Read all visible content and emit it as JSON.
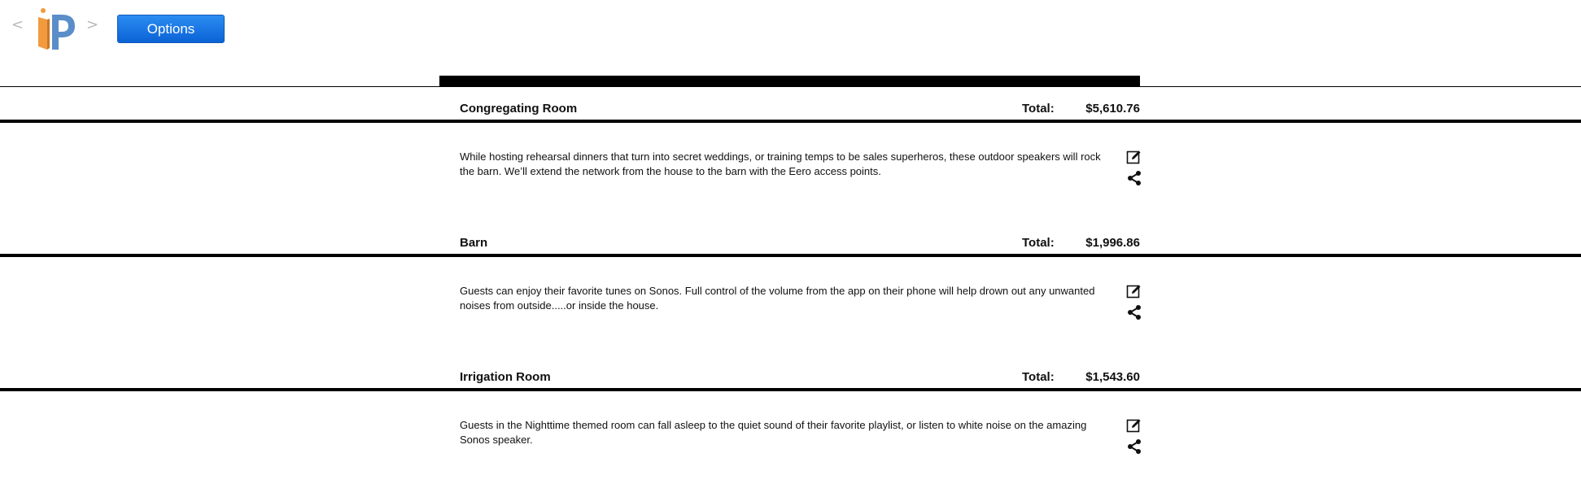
{
  "nav": {
    "prev_label": "<",
    "next_label": ">"
  },
  "toolbar": {
    "options_label": "Options"
  },
  "rooms": [
    {
      "title": "Congregating Room",
      "total_label": "Total:",
      "total_value": "$5,610.76",
      "description": "While hosting rehearsal dinners that turn into secret weddings, or training temps to be sales superheros, these outdoor speakers will rock the barn. We’ll extend the network from the house to the barn with the Eero access points."
    },
    {
      "title": "Barn",
      "total_label": "Total:",
      "total_value": "$1,996.86",
      "description": "Guests can enjoy their favorite tunes on Sonos. Full control of the volume from the app on their phone will help drown out any unwanted noises from outside.....or inside the house."
    },
    {
      "title": "Irrigation Room",
      "total_label": "Total:",
      "total_value": "$1,543.60",
      "description": "Guests in the Nighttime themed room can fall asleep to the quiet sound of their favorite playlist, or listen to white noise on the amazing Sonos speaker."
    }
  ],
  "icons": {
    "edit": "edit-icon",
    "share": "share-icon"
  },
  "colors": {
    "options_button": "#0b63d6",
    "logo_orange": "#f19a3e",
    "logo_blue": "#5b8ec9"
  }
}
